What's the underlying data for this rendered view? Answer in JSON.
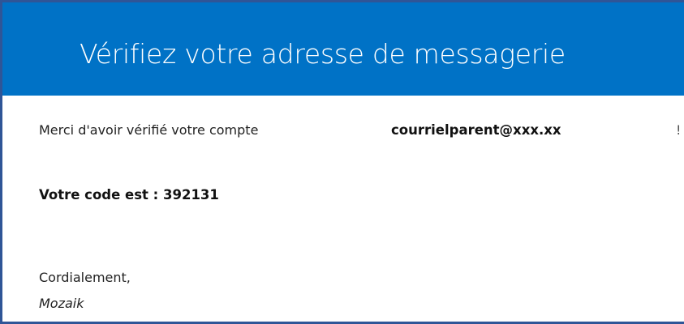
{
  "header": {
    "title": "Vérifiez votre adresse de messagerie"
  },
  "message": {
    "thanks_text": "Merci d'avoir vérifié votre compte",
    "email": "courrielparent@xxx.xx",
    "exclamation": "!",
    "code_line": "Votre code est : 392131",
    "closing": "Cordialement,",
    "signature": "Mozaik"
  },
  "colors": {
    "header_background": "#0072c6",
    "frame_border": "#2f5597",
    "header_text": "#ffffff"
  }
}
